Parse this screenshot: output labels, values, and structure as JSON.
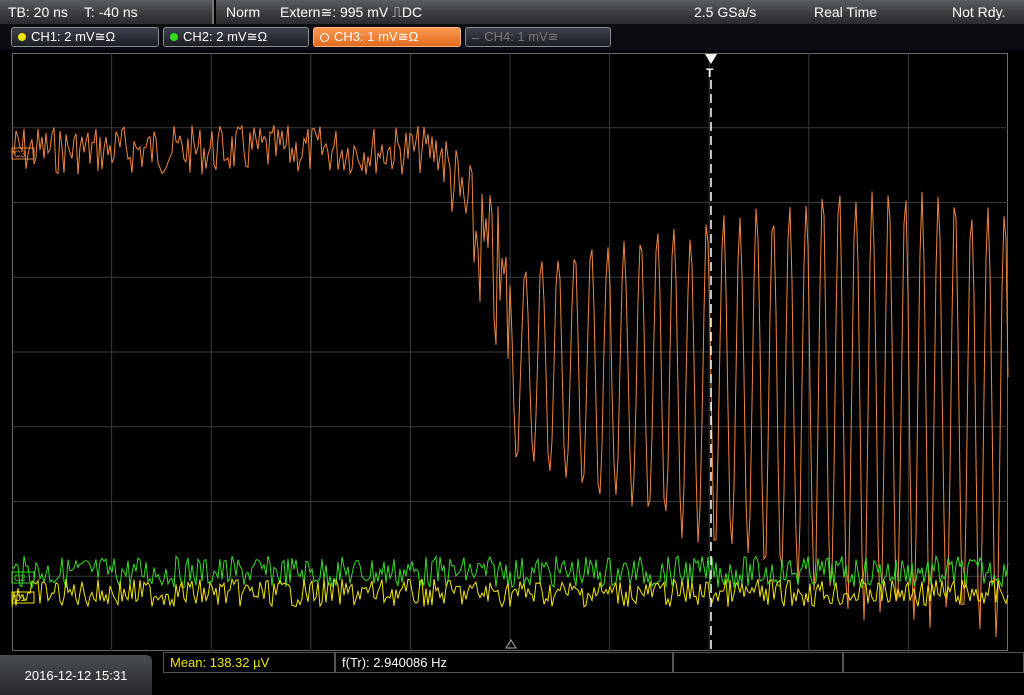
{
  "header": {
    "timebase": "TB: 20 ns",
    "trigger_time": "T: -40 ns",
    "mode": "Norm",
    "trigger_source": "Extern≅: 995 mV ⎍DC",
    "sample_rate": "2.5 GSa/s",
    "acq_mode": "Real Time",
    "status": "Not Rdy."
  },
  "channels": [
    {
      "label": "CH1: 2 mV≅Ω",
      "color": "#f2e600",
      "active": true
    },
    {
      "label": "CH2: 2 mV≅Ω",
      "color": "#33dd22",
      "active": true
    },
    {
      "label": "CH3: 1 mV≅Ω",
      "color": "#f0873c",
      "active": true
    },
    {
      "label": "CH4: 1 mV≅",
      "color": "#666666",
      "active": false
    }
  ],
  "measurements": {
    "mean": "Mean: 138.32 µV",
    "freq": "f(Tr): 2.940086 Hz"
  },
  "datetime": "2016-12-12 15:31",
  "markers": {
    "ch3": "C3",
    "ch2": "C2",
    "ch1": "C1",
    "trigger": "T"
  }
}
